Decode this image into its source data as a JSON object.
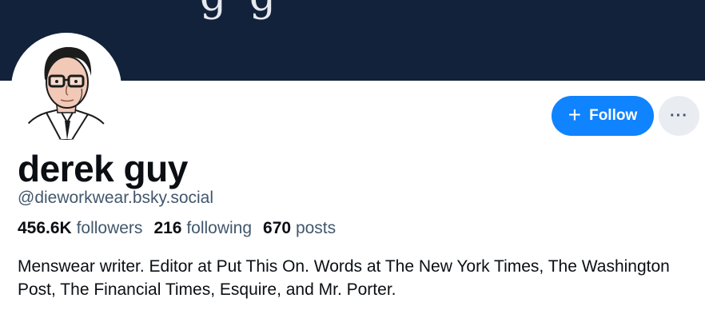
{
  "banner": {
    "glyphs": "g g"
  },
  "profile": {
    "display_name": "derek guy",
    "handle": "@dieworkwear.bsky.social",
    "bio": "Menswear writer. Editor at Put This On. Words at The New York Times, The Washington Post, The Financial Times, Esquire, and Mr. Porter."
  },
  "stats": {
    "followers_count": "456.6K",
    "followers_label": "followers",
    "following_count": "216",
    "following_label": "following",
    "posts_count": "670",
    "posts_label": "posts"
  },
  "actions": {
    "follow_icon": "plus",
    "follow_label": "Follow",
    "more_icon": "···"
  },
  "colors": {
    "banner": "#13223b",
    "accent": "#1083fe",
    "muted_text": "#42576c",
    "more_button_bg": "#e9edf1"
  }
}
